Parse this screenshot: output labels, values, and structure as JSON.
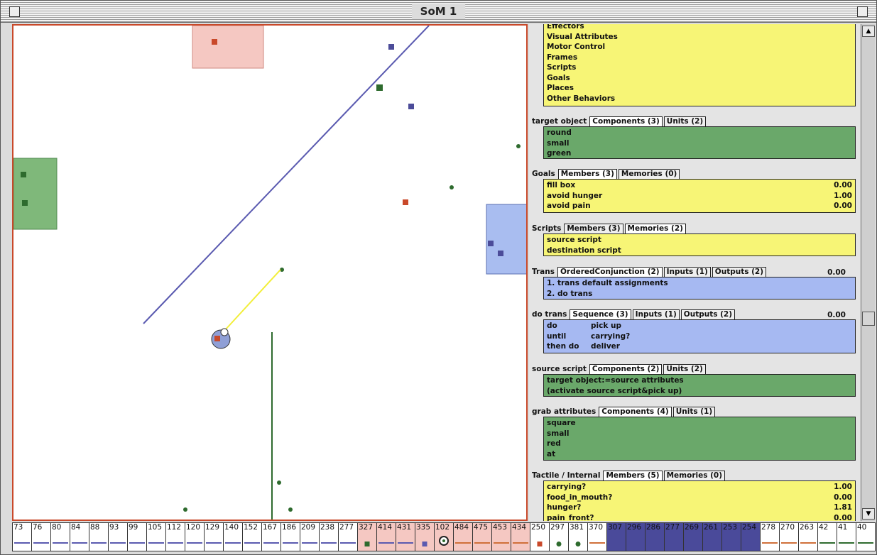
{
  "window": {
    "title": "SoM 1"
  },
  "colors": {
    "yellow": "#f7f576",
    "green": "#6aa86a",
    "blue": "#a6b9f2",
    "border_red": "#c9492a",
    "line_blue": "#5a5ab0"
  },
  "panel": {
    "behaviors": [
      "Effectors",
      "Visual Attributes",
      "Motor Control",
      "Frames",
      "Scripts",
      "Goals",
      "Places",
      "Other Behaviors"
    ],
    "target_object": {
      "label": "target object",
      "tabs": [
        "Components (3)",
        "Units (2)"
      ],
      "items": [
        "round",
        "small",
        "green"
      ]
    },
    "goals": {
      "label": "Goals",
      "tabs": [
        "Members (3)",
        "Memories (0)"
      ],
      "items": [
        {
          "name": "fill box",
          "value": "0.00"
        },
        {
          "name": "avoid hunger",
          "value": "1.00"
        },
        {
          "name": "avoid pain",
          "value": "0.00"
        }
      ]
    },
    "scripts": {
      "label": "Scripts",
      "tabs": [
        "Members (3)",
        "Memories (2)"
      ],
      "items": [
        "source script",
        "destination script"
      ]
    },
    "trans": {
      "label": "Trans",
      "tabs": [
        "OrderedConjunction (2)",
        "Inputs (1)",
        "Outputs (2)"
      ],
      "value": "0.00",
      "items": [
        "1. trans default assignments",
        "2. do trans"
      ]
    },
    "do_trans": {
      "label": "do trans",
      "tabs": [
        "Sequence (3)",
        "Inputs (1)",
        "Outputs (2)"
      ],
      "value": "0.00",
      "items": [
        {
          "k": "do",
          "v": "pick up"
        },
        {
          "k": "until",
          "v": "carrying?"
        },
        {
          "k": "then do",
          "v": "deliver"
        }
      ]
    },
    "source_script": {
      "label": "source script",
      "tabs": [
        "Components (2)",
        "Units (2)"
      ],
      "items": [
        "target object:=source attributes",
        "(activate source script&pick up)"
      ]
    },
    "grab_attributes": {
      "label": "grab attributes",
      "tabs": [
        "Components (4)",
        "Units (1)"
      ],
      "items": [
        "square",
        "small",
        "red",
        "at"
      ]
    },
    "tactile": {
      "label": "Tactile / Internal",
      "tabs": [
        "Members (5)",
        "Memories (0)"
      ],
      "items": [
        {
          "name": "carrying?",
          "value": "1.00"
        },
        {
          "name": "food_in_mouth?",
          "value": "0.00"
        },
        {
          "name": "hunger?",
          "value": "1.81"
        },
        {
          "name": "pain_front?",
          "value": "0.00"
        }
      ]
    }
  },
  "strip": {
    "numbers": [
      "73",
      "76",
      "80",
      "84",
      "88",
      "93",
      "99",
      "105",
      "112",
      "120",
      "129",
      "140",
      "152",
      "167",
      "186",
      "209",
      "238",
      "277",
      "327",
      "414",
      "431",
      "335",
      "102",
      "484",
      "475",
      "453",
      "434",
      "250",
      "297",
      "381",
      "370",
      "307",
      "296",
      "286",
      "277",
      "269",
      "261",
      "253",
      "254",
      "278",
      "270",
      "263",
      "42",
      "41",
      "40"
    ]
  },
  "world": {
    "objects": [
      {
        "type": "zone",
        "color": "#f5c8c2"
      },
      {
        "type": "zone",
        "color": "#7fb87a"
      },
      {
        "type": "zone",
        "color": "#a9bdf0"
      }
    ]
  }
}
